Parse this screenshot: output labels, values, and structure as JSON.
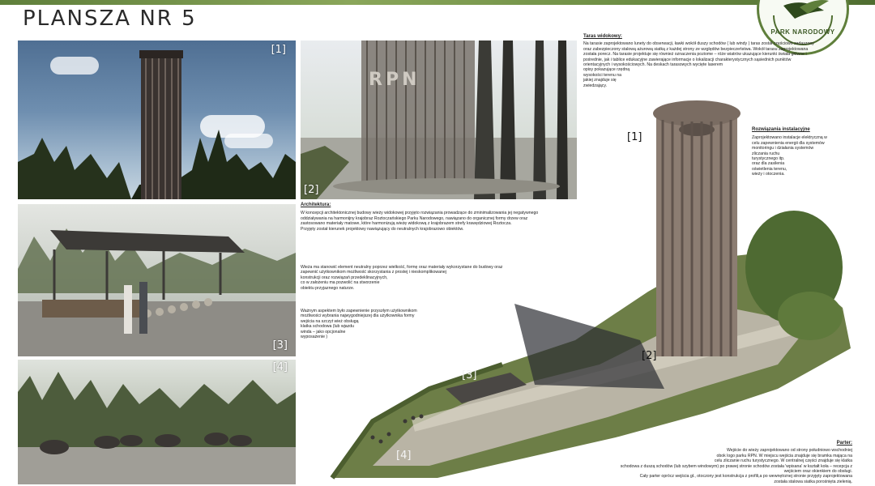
{
  "board_title": "PLANSZA NR 5",
  "logo_text": "PARK NARODOWY",
  "panels": {
    "p1": "[1]",
    "p2": "[2]",
    "p3": "[3]",
    "p4": "[4]",
    "p2_sign": "RPN"
  },
  "render_labels": {
    "r1": "[1]",
    "r2": "[2]",
    "r3": "[3]",
    "r4": "[4]"
  },
  "taras": {
    "header": "Taras widokowy:",
    "lines": [
      "Na tarasie zaprojektowano lunety do obserwacji, ławki wokół duszy schodów ( lub windy ) taras został częściowo zadaszony",
      "oraz zabezpieczony stalową ażurową siatką z każdej strony ze względów bezpieczeństwa. Wokół tarasu zaprojektowana",
      "została porecz. Na tarasie projektuje się również oznaczenia poziome – róże wiatrów ukazujące kierunki świata główne i",
      "pośrednie, jak i tablice edukacyjne zawierające informacje o lokalizacji charakterystycznych sąsiednich punktów",
      "orientacyjnych i wysokościowych. Na deskach tarasowych wycięte laserem",
      "opisy pokazujące rzędną",
      "wysokości terenu na",
      "jakiej znajduje się",
      "zwiedzający."
    ]
  },
  "instal": {
    "header": "Rozwiązania instalacyjne",
    "lines": [
      "Zaprojektowano instalacje elektryczną w",
      "celu zapewnienia energii dla systemów",
      "monitoringu i działania systemów",
      "zliczania ruchu",
      "turystycznego itp.",
      "oraz dla zasilenia",
      "oświetlenia terenu,",
      "wieży i otoczenia."
    ]
  },
  "arch": {
    "header": "Architektura:",
    "p1": [
      "W koncepcji architektonicznej budowy wieży widokowej przyjęto rozwiązania prowadzące do zminimalizowania jej negatywnego",
      "oddziaływania na harmonijny krajobraz Roztoczańskiego Parku Narodowego, nawiązano do organicznej formy drzew oraz",
      "zastosowano materiały matowe, które harmonizują wieżę widokową z krajobrazem strefy krawędziowej Roztocza.",
      "Przyjęty został kierunek projektowy nawiązujący do neutralnych krajobrazowo obiektów."
    ],
    "p2": [
      "Wieża ma stanowić element neutralny poprzez wielkość, formę oraz materiały wykorzystane do budowy oraz",
      "zapewnić użytkownikom możliwość skorzystania z prostej i nieskomplikowanej",
      "konstrukcji oraz rozwiązań przedeklinacyjnych,",
      "co w założeniu ma pozwolić na stworzenie",
      "obiektu przyjaznego naturze."
    ],
    "p3": [
      "Ważnym aspektem było zapewnienie przyszłym użytkownikom",
      "możliwości wybrania najwygodniejszej dla użytkownika formy",
      "wejścia na szczyt wież obsługą",
      "klatka schodowa (lub wjazdu",
      "winda – jako opcjonalne",
      "wyposażenie )"
    ]
  },
  "parter": {
    "header": "Parter:",
    "lines": [
      "Wejście do wieży zaprojektowano od strony południowo wschodniej",
      "obok logo parku RPN. W miejscu wejścia znajduje się bramka mająca na",
      "celu zliczanie ruchu turystycznego. W centralnej części znajduje się klatka",
      "schodowa z duszą schodów (lub szybem windowym) po prawej stronie schodów została 'wpisana' w kształt koła – recepcja z",
      "wejściem oraz okienkiem do obsługi.",
      "Cały parter oprócz wejścia gł., otoczony jest konstrukcja z profili,a po wewnętrznej stronie przyjęty zaprojektowana",
      "została stalowa siatka porośnięta zielenią."
    ]
  }
}
